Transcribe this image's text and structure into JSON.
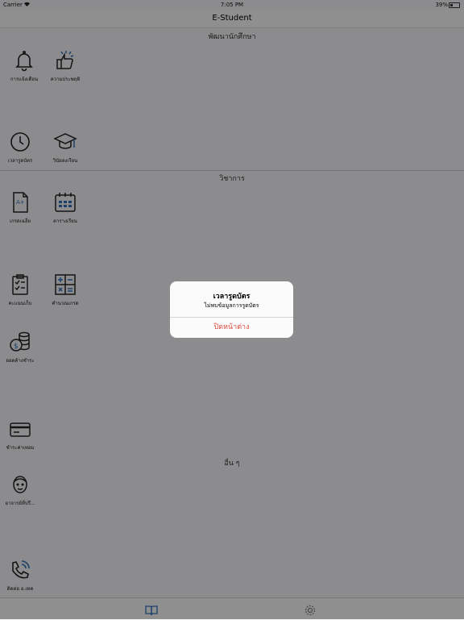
{
  "status_bar": {
    "carrier": "Carrier",
    "time": "7:05 PM",
    "battery": "39%"
  },
  "nav": {
    "title": "E-Student"
  },
  "sections": [
    {
      "header": "พัฒนานักศึกษา",
      "items": [
        {
          "label": "การแจ้งเตือน",
          "icon": "bell-icon"
        },
        {
          "label": "ความประพฤติ",
          "icon": "thumbs-up-icon"
        },
        {
          "label": "เวลารูดบัตร",
          "icon": "clock-icon"
        },
        {
          "label": "วินัยลงเรียน",
          "icon": "graduation-cap-icon"
        }
      ]
    },
    {
      "header": "วิชาการ",
      "items": [
        {
          "label": "เกรดเฉลี่ย",
          "icon": "grade-document-icon"
        },
        {
          "label": "ตารางเรียน",
          "icon": "calendar-icon"
        },
        {
          "label": "คะแนนเก็บ",
          "icon": "clipboard-checklist-icon"
        },
        {
          "label": "คำนวณเกรด",
          "icon": "calculator-icon"
        },
        {
          "label": "ยอดค้างชำระ",
          "icon": "coins-icon"
        },
        {
          "label": "ชำระค่าเทอม",
          "icon": "credit-card-icon"
        }
      ]
    },
    {
      "header": "อื่น ๆ",
      "items": [
        {
          "label": "อาจารย์ที่ปรึ...",
          "icon": "advisor-face-icon"
        },
        {
          "label": "ติดต่อ อ.เทค",
          "icon": "phone-call-icon"
        }
      ]
    }
  ],
  "tab_bar": {
    "tabs": [
      {
        "icon": "book-icon",
        "selected": true
      },
      {
        "icon": "gear-icon",
        "selected": false
      }
    ]
  },
  "alert": {
    "title": "เวลารูดบัตร",
    "message": "ไม่พบข้อมูลการรูดบัตร",
    "button": "ปิดหน้าต่าง"
  },
  "colors": {
    "accent": "#2f6fb5",
    "destructive": "#e0463b",
    "dim_overlay": "rgba(0,0,0,0.42)"
  }
}
